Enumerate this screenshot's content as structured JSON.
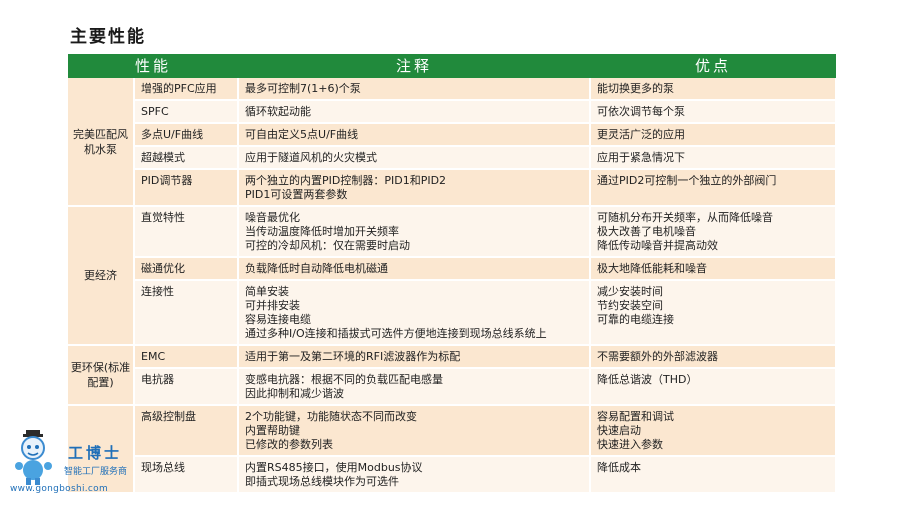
{
  "title": "主要性能",
  "headers": [
    "性能",
    "注释",
    "优点"
  ],
  "groups": [
    {
      "label": "完美匹配风机水泵",
      "rows": [
        {
          "feature": "增强的PFC应用",
          "note": [
            "最多可控制7(1+6)个泵"
          ],
          "benefit": [
            "能切换更多的泵"
          ]
        },
        {
          "feature": "SPFC",
          "note": [
            "循环软起动能"
          ],
          "benefit": [
            "可依次调节每个泵"
          ]
        },
        {
          "feature": "多点U/F曲线",
          "note": [
            "可自由定义5点U/F曲线"
          ],
          "benefit": [
            "更灵活广泛的应用"
          ]
        },
        {
          "feature": "超越模式",
          "note": [
            "应用于隧道风机的火灾模式"
          ],
          "benefit": [
            "应用于紧急情况下"
          ]
        },
        {
          "feature": "PID调节器",
          "note": [
            "两个独立的内置PID控制器：PID1和PID2",
            "PID1可设置两套参数"
          ],
          "benefit": [
            "通过PID2可控制一个独立的外部阀门"
          ]
        }
      ]
    },
    {
      "label": "更经济",
      "rows": [
        {
          "feature": "直觉特性",
          "note": [
            "噪音最优化",
            "当传动温度降低时增加开关频率",
            "可控的冷却风机：仅在需要时启动"
          ],
          "benefit": [
            "可随机分布开关频率，从而降低噪音",
            "极大改善了电机噪音",
            "降低传动噪音并提高动效"
          ]
        },
        {
          "feature": "磁通优化",
          "note": [
            "负载降低时自动降低电机磁通"
          ],
          "benefit": [
            "极大地降低能耗和噪音"
          ]
        },
        {
          "feature": "连接性",
          "note": [
            "简单安装",
            "可并排安装",
            "容易连接电缆",
            "通过多种I/O连接和插拔式可选件方便地连接到现场总线系统上"
          ],
          "benefit": [
            "减少安装时间",
            "节约安装空间",
            "可靠的电缆连接"
          ]
        }
      ]
    },
    {
      "label": "更环保(标准配置)",
      "rows": [
        {
          "feature": "EMC",
          "note": [
            "适用于第一及第二环境的RFI滤波器作为标配"
          ],
          "benefit": [
            "不需要额外的外部滤波器"
          ]
        },
        {
          "feature": "电抗器",
          "note": [
            "变感电抗器：根据不同的负载匹配电感量",
            "因此抑制和减少谐波"
          ],
          "benefit": [
            "降低总谐波（THD）"
          ]
        }
      ]
    },
    {
      "label": "",
      "rows": [
        {
          "feature": "高级控制盘",
          "note": [
            "2个功能键，功能随状态不同而改变",
            "内置帮助键",
            "已修改的参数列表"
          ],
          "benefit": [
            "容易配置和调试",
            "快速启动",
            "快速进入参数"
          ]
        },
        {
          "feature": "现场总线",
          "note": [
            "内置RS485接口，使用Modbus协议",
            "即插式现场总线模块作为可选件"
          ],
          "benefit": [
            "降低成本"
          ]
        }
      ]
    }
  ],
  "watermark": {
    "brand": "工博士",
    "subtitle": "智能工厂服务商",
    "url": "www.gongboshi.com",
    "icon": "robot-mascot-icon"
  }
}
